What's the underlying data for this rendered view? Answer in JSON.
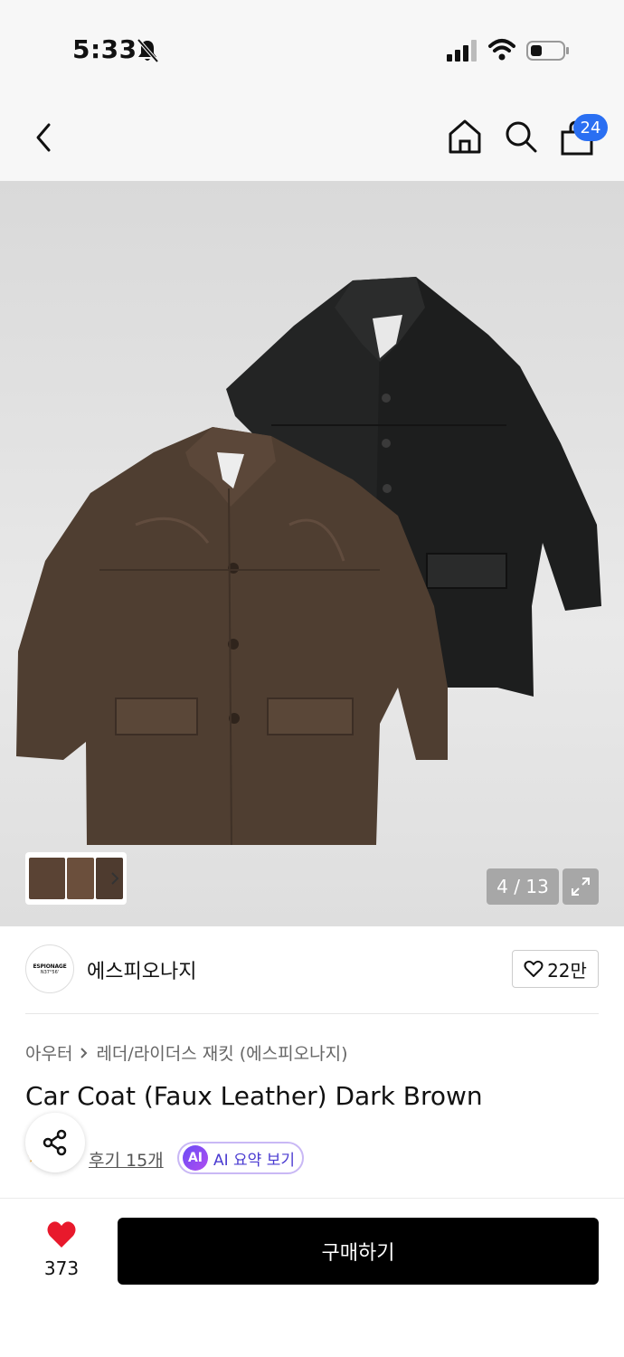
{
  "status_bar": {
    "time": "5:33",
    "icons": [
      "bell-muted-icon",
      "signal-icon",
      "wifi-icon",
      "battery-icon"
    ]
  },
  "nav": {
    "icons": [
      "back-icon",
      "home-icon",
      "search-icon",
      "shopping-bag-icon"
    ],
    "cart_count": "24"
  },
  "gallery": {
    "counter": "4 / 13",
    "thumbnail_strip_icon": "chevron-right-icon",
    "expand_icon": "expand-icon"
  },
  "brand": {
    "logo_line1": "ESPIONAGE",
    "logo_line2": "N37°56'",
    "name": "에스피오나지",
    "likes": "22만"
  },
  "breadcrumb": {
    "category": "아우터",
    "subcategory": "레더/라이더스 재킷 (에스피오나지)"
  },
  "product": {
    "title": "Car Coat (Faux Leather) Dark Brown",
    "reviews": "후기 15개",
    "ai_badge": "AI",
    "ai_summary": "AI 요약 보기"
  },
  "bottom_bar": {
    "favorite_count": "373",
    "buy_label": "구매하기"
  },
  "colors": {
    "cart_badge": "#2a6ff2",
    "heart": "#e8192c",
    "buy_button": "#000000",
    "ai_accent": "#6a4cf6"
  }
}
